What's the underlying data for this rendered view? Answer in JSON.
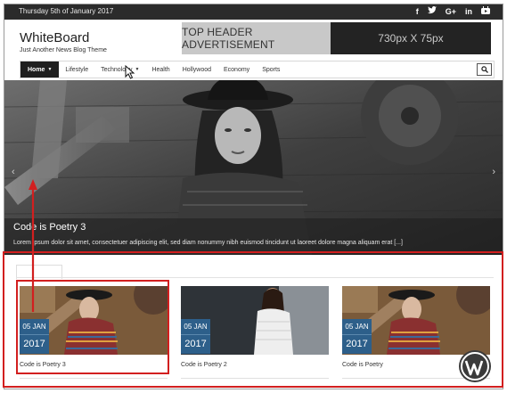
{
  "topbar": {
    "date": "Thursday 5th of January 2017",
    "social_icons": [
      "facebook-icon",
      "twitter-icon",
      "google-plus-icon",
      "linkedin-icon",
      "youtube-icon"
    ],
    "social_glyphs": [
      "f",
      "🐦",
      "G+",
      "in",
      "▶"
    ]
  },
  "brand": {
    "title": "WhiteBoard",
    "tagline": "Just Another News Blog Theme"
  },
  "ad": {
    "left_text": "TOP HEADER ADVERTISEMENT",
    "right_text": "730px X 75px"
  },
  "nav": {
    "items": [
      "Home",
      "Lifestyle",
      "Technology",
      "Health",
      "Hollywood",
      "Economy",
      "Sports"
    ],
    "active_index": 0
  },
  "hero": {
    "title": "Code is Poetry 3",
    "excerpt": "Lorem ipsum dolor sit amet, consectetuer adipiscing elit, sed diam nonummy nibh euismod tincidunt ut laoreet dolore magna aliquam erat [...]",
    "prev_glyph": "‹",
    "next_glyph": "›"
  },
  "cards": [
    {
      "day": "05 JAN",
      "year": "2017",
      "title": "Code is Poetry 3"
    },
    {
      "day": "05 JAN",
      "year": "2017",
      "title": "Code is Poetry 2"
    },
    {
      "day": "05 JAN",
      "year": "2017",
      "title": "Code is Poetry"
    }
  ],
  "colors": {
    "topbar": "#2b2b2b",
    "badge": "#2d5f8a",
    "highlight": "#d21f1f"
  }
}
